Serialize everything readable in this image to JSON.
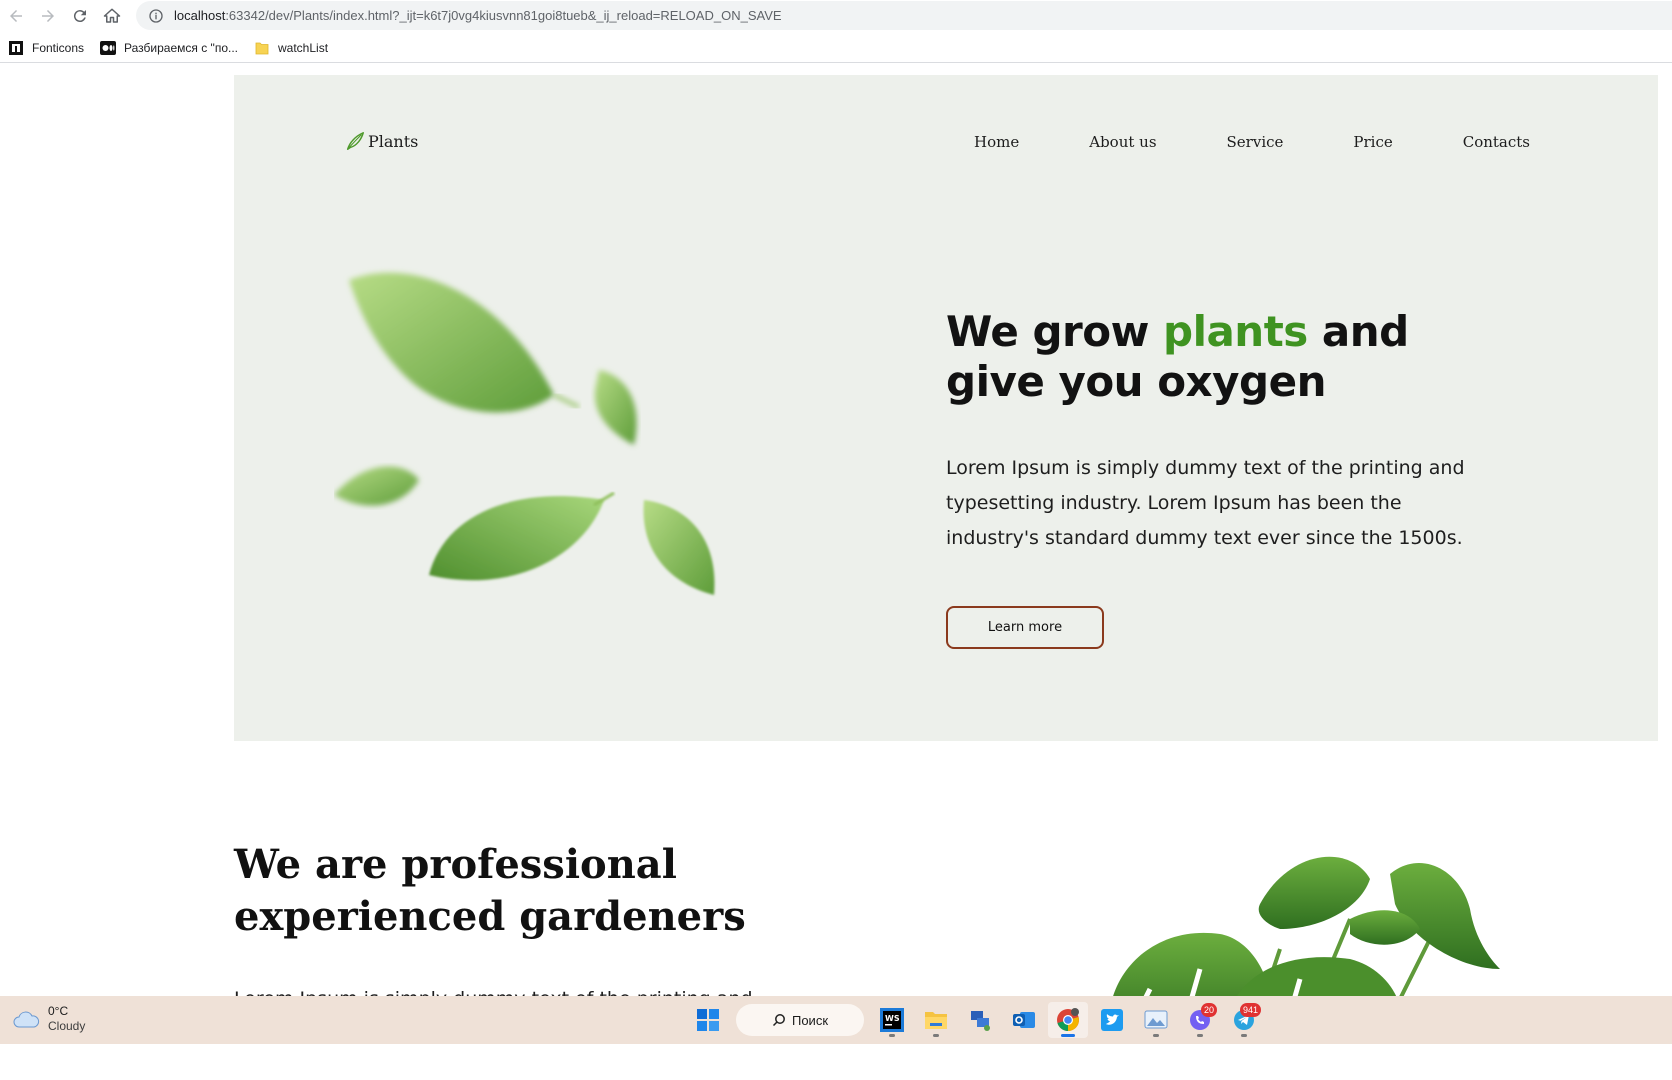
{
  "browser": {
    "url_host": "localhost",
    "url_rest": ":63342/dev/Plants/index.html?_ijt=k6t7j0vg4kiusvnn81goi8tueb&_ij_reload=RELOAD_ON_SAVE",
    "bookmarks": [
      {
        "label": "Fonticons",
        "icon": "fonticons-icon"
      },
      {
        "label": "Разбираемся с \"по...",
        "icon": "medium-icon"
      },
      {
        "label": "watchList",
        "icon": "folder-icon"
      }
    ]
  },
  "site": {
    "logo": "Plants",
    "menu": [
      "Home",
      "About us",
      "Service",
      "Price",
      "Contacts"
    ],
    "hero": {
      "title_before": "We grow ",
      "title_accent": "plants",
      "title_after": " and give you oxygen",
      "description": "Lorem Ipsum is simply dummy text of the printing and typesetting industry. Lorem Ipsum has been the industry's standard dummy text ever since the 1500s.",
      "button": "Learn more"
    },
    "about": {
      "title_line1": "We are professional",
      "title_line2": "experienced gardeners",
      "description": "Lorem Ipsum is simply dummy text of the printing and"
    },
    "colors": {
      "hero_bg": "#edf0eb",
      "accent": "#3f9321",
      "button_border": "#8b3a1d"
    }
  },
  "taskbar": {
    "weather_temp": "0°C",
    "weather_condition": "Cloudy",
    "search_label": "Поиск",
    "apps": [
      {
        "name": "webstorm-icon"
      },
      {
        "name": "file-explorer-icon"
      },
      {
        "name": "network-icon"
      },
      {
        "name": "outlook-icon"
      },
      {
        "name": "chrome-icon",
        "active": true
      },
      {
        "name": "twitter-icon"
      },
      {
        "name": "photos-icon"
      },
      {
        "name": "viber-icon",
        "badge": "20"
      },
      {
        "name": "telegram-icon",
        "badge": "941"
      }
    ]
  }
}
